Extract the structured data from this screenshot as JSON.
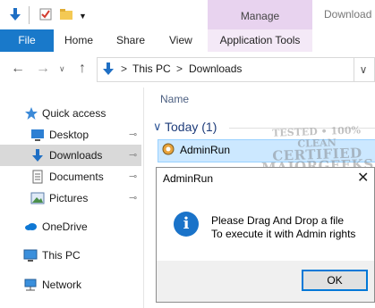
{
  "window": {
    "title_right": "Download",
    "manage_label": "Manage"
  },
  "ribbon": {
    "tabs": [
      "File",
      "Home",
      "Share",
      "View",
      "Application Tools"
    ]
  },
  "address": {
    "segments": [
      "This PC",
      "Downloads"
    ],
    "separator": ">"
  },
  "nav_pane": {
    "items": [
      {
        "label": "Quick access",
        "icon": "star-icon"
      },
      {
        "label": "Desktop",
        "icon": "desktop-icon",
        "pinned": true
      },
      {
        "label": "Downloads",
        "icon": "download-arrow-icon",
        "pinned": true,
        "selected": true
      },
      {
        "label": "Documents",
        "icon": "document-icon",
        "pinned": true
      },
      {
        "label": "Pictures",
        "icon": "pictures-icon",
        "pinned": true
      },
      {
        "label": "OneDrive",
        "icon": "cloud-icon"
      },
      {
        "label": "This PC",
        "icon": "computer-icon"
      },
      {
        "label": "Network",
        "icon": "network-icon"
      }
    ]
  },
  "content": {
    "column_name": "Name",
    "group_title": "Today (1)",
    "files": [
      {
        "name": "AdminRun",
        "icon": "app-icon"
      }
    ],
    "watermark": [
      "TESTED • 100% CLEAN",
      "CERTIFIED",
      "MAJORGEEKS",
      "★★★★★★★"
    ]
  },
  "dialog": {
    "title": "AdminRun",
    "close": "✕",
    "message_line1": "Please Drag And Drop a file",
    "message_line2": "To execute it with Admin rights",
    "ok_label": "OK",
    "icon": "info-icon"
  },
  "colors": {
    "accent": "#1979ca",
    "manage_tab": "#e8d3ef",
    "selection": "#cce8ff"
  }
}
